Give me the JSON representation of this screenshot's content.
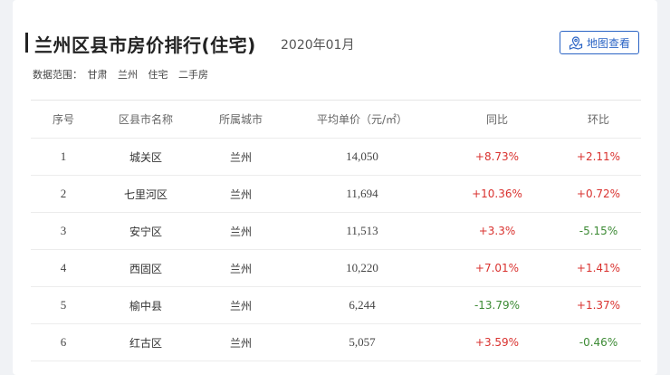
{
  "header": {
    "title": "兰州区县市房价排行(住宅)",
    "date": "2020年01月",
    "map_button": "地图查看"
  },
  "scope": {
    "label": "数据范围：",
    "items": [
      "甘肃",
      "兰州",
      "住宅",
      "二手房"
    ]
  },
  "table": {
    "columns": [
      "序号",
      "区县市名称",
      "所属城市",
      "平均单价（元/㎡）",
      "同比",
      "环比"
    ],
    "rows": [
      {
        "rank": "1",
        "district": "城关区",
        "city": "兰州",
        "price": "14,050",
        "yoy": "+8.73%",
        "mom": "+2.11%"
      },
      {
        "rank": "2",
        "district": "七里河区",
        "city": "兰州",
        "price": "11,694",
        "yoy": "+10.36%",
        "mom": "+0.72%"
      },
      {
        "rank": "3",
        "district": "安宁区",
        "city": "兰州",
        "price": "11,513",
        "yoy": "+3.3%",
        "mom": "-5.15%"
      },
      {
        "rank": "4",
        "district": "西固区",
        "city": "兰州",
        "price": "10,220",
        "yoy": "+7.01%",
        "mom": "+1.41%"
      },
      {
        "rank": "5",
        "district": "榆中县",
        "city": "兰州",
        "price": "6,244",
        "yoy": "-13.79%",
        "mom": "+1.37%"
      },
      {
        "rank": "6",
        "district": "红古区",
        "city": "兰州",
        "price": "5,057",
        "yoy": "+3.59%",
        "mom": "-0.46%"
      }
    ]
  },
  "colors": {
    "increase": "#d9322f",
    "decrease": "#3c8a34",
    "accent": "#2b64c5"
  }
}
